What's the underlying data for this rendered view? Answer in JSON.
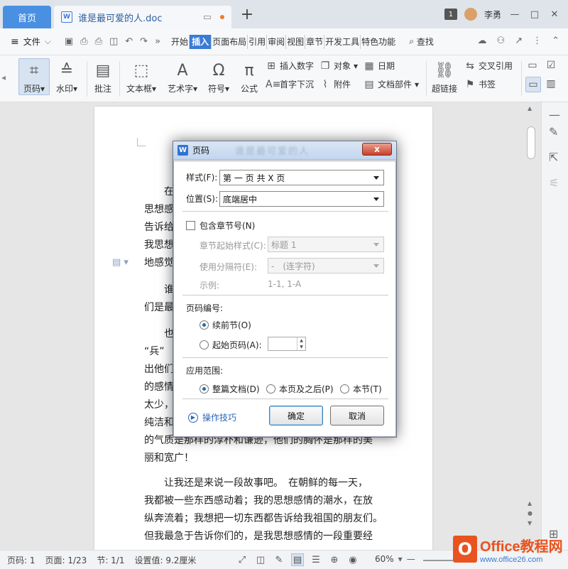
{
  "tabs": {
    "home": "首页",
    "doc_title": "谁是最可爱的人.doc"
  },
  "topbar": {
    "badge": "1",
    "username": "李勇"
  },
  "menu": {
    "file": "文件",
    "tabs": [
      "开始",
      "插入",
      "页面布局",
      "引用",
      "审阅",
      "视图",
      "章节",
      "开发工具",
      "特色功能"
    ],
    "active_tab": "插入",
    "search": "查找"
  },
  "ribbon": {
    "page_number": "页码",
    "watermark": "水印",
    "comment": "批注",
    "textbox": "文本框",
    "wordart": "艺术字",
    "symbol": "符号",
    "formula": "公式",
    "insert_number": "插入数字",
    "object": "对象",
    "date": "日期",
    "dropcap": "首字下沉",
    "attachment": "附件",
    "doc_parts": "文档部件",
    "hyperlink": "超链接",
    "cross_ref": "交叉引用",
    "bookmark": "书签"
  },
  "document": {
    "paragraphs": [
      [
        "在",
        "思想感",
        "告诉给",
        "我思想",
        "地感觉"
      ],
      [
        "谁",
        "们是最"
      ],
      [
        "也",
        "“兵”",
        "出他们",
        "的感情",
        "太少，",
        "纯洁和",
        "的气质是那样的淳朴和谦逊，他们的胸怀是那样的美",
        "丽和宽广！"
      ],
      [
        "　　让我还是来说一段故事吧。　在朝鲜的每一天，",
        "我都被一些东西感动着；我的思想感情的潮水，在放",
        "纵奔流着；我想把一切东西都告诉给我祖国的朋友们。",
        "但我最急于告诉你们的，是我思想感情的一段重要经"
      ]
    ]
  },
  "dialog": {
    "title": "页码",
    "title_blur": "谁是最可爱的人",
    "close": "x",
    "style_label": "样式(F):",
    "style_value": "第 一 页 共 X 页",
    "position_label": "位置(S):",
    "position_value": "底端居中",
    "include_chapter": "包含章节号(N)",
    "chapter_style_label": "章节起始样式(C):",
    "chapter_style_value": "标题 1",
    "separator_label": "使用分隔符(E):",
    "separator_value": "-　(连字符)",
    "example_label": "示例:",
    "example_value": "1-1, 1-A",
    "numbering_title": "页码编号:",
    "continue_prev": "续前节(O)",
    "start_at": "起始页码(A):",
    "scope_title": "应用范围:",
    "scope_whole": "整篇文档(D)",
    "scope_after": "本页及之后(P)",
    "scope_section": "本节(T)",
    "tips": "操作技巧",
    "ok": "确定",
    "cancel": "取消"
  },
  "status": {
    "page_code": "页码: 1",
    "page": "页面: 1/23",
    "section": "节: 1/1",
    "setting": "设置值: 9.2厘米",
    "zoom": "60%"
  },
  "logo": {
    "main": "Office教程网",
    "sub": "www.office26.com"
  }
}
